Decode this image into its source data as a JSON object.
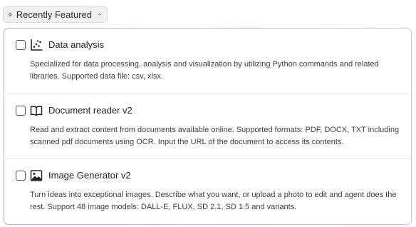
{
  "header": {
    "label": "Recently Featured",
    "icon": "flame-icon",
    "chevron": "chevron-up-icon"
  },
  "items": [
    {
      "title": "Data analysis",
      "icon": "scatter-chart-icon",
      "checked": false,
      "description": "Specialized for data processing, analysis and visualization by utilizing Python commands and related libraries. Supported data file: csv, xlsx."
    },
    {
      "title": "Document reader v2",
      "icon": "open-book-icon",
      "checked": false,
      "description": "Read and extract content from documents available online. Supported formats: PDF, DOCX, TXT including scanned pdf documents using OCR. Input the URL of the document to access its contents."
    },
    {
      "title": "Image Generator v2",
      "icon": "image-icon",
      "checked": false,
      "description": "Turn ideas into exceptional images. Describe what you want, or upload a photo to edit and agent does the rest. Support 48 image models: DALL-E, FLUX, SD 2.1, SD 1.5 and variants."
    }
  ],
  "colors": {
    "accent_border_start": "#b9a8ee",
    "accent_border_end": "#efb3cf",
    "header_bg": "#eef0f2"
  }
}
